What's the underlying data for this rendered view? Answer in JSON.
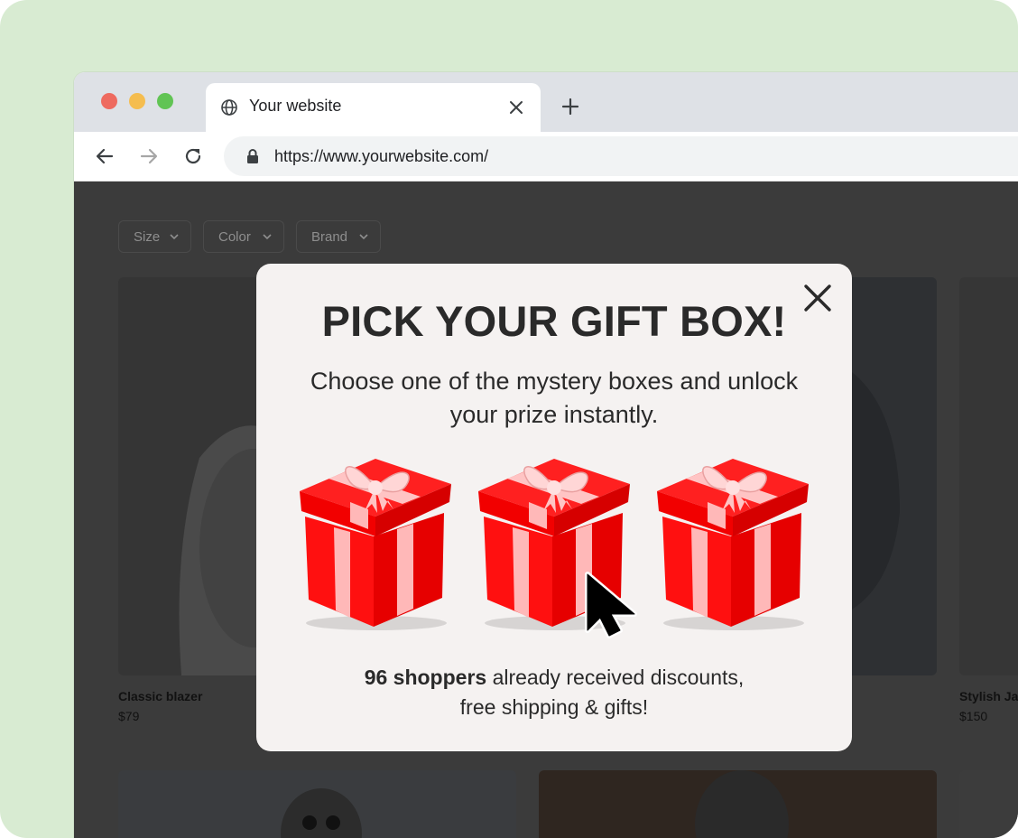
{
  "browser": {
    "tab_title": "Your website",
    "url": "https://www.yourwebsite.com/"
  },
  "filters": [
    {
      "label": "Size"
    },
    {
      "label": "Color"
    },
    {
      "label": "Brand"
    }
  ],
  "products": [
    {
      "name": "Classic blazer",
      "price": "$79"
    },
    {
      "name": "Stylish Ja",
      "price": "$150"
    }
  ],
  "popup": {
    "title": "PICK YOUR GIFT BOX!",
    "subtitle": "Choose one of the mystery boxes and unlock your prize instantly.",
    "social_count": "96 shoppers",
    "social_rest_1": " already received discounts,",
    "social_rest_2": "free shipping & gifts!",
    "gift_count": 3
  },
  "colors": {
    "frame_bg": "#d8ebd2",
    "overlay_bg": "#3b3b3b",
    "popup_bg": "#f5f2f1",
    "gift_red": "#f20000",
    "ribbon": "#ffb8b8"
  },
  "icons": [
    "globe-icon",
    "close-icon",
    "plus-icon",
    "back-arrow-icon",
    "forward-arrow-icon",
    "reload-icon",
    "lock-icon",
    "chevron-down-icon",
    "gift-box-icon",
    "mouse-cursor-icon"
  ]
}
